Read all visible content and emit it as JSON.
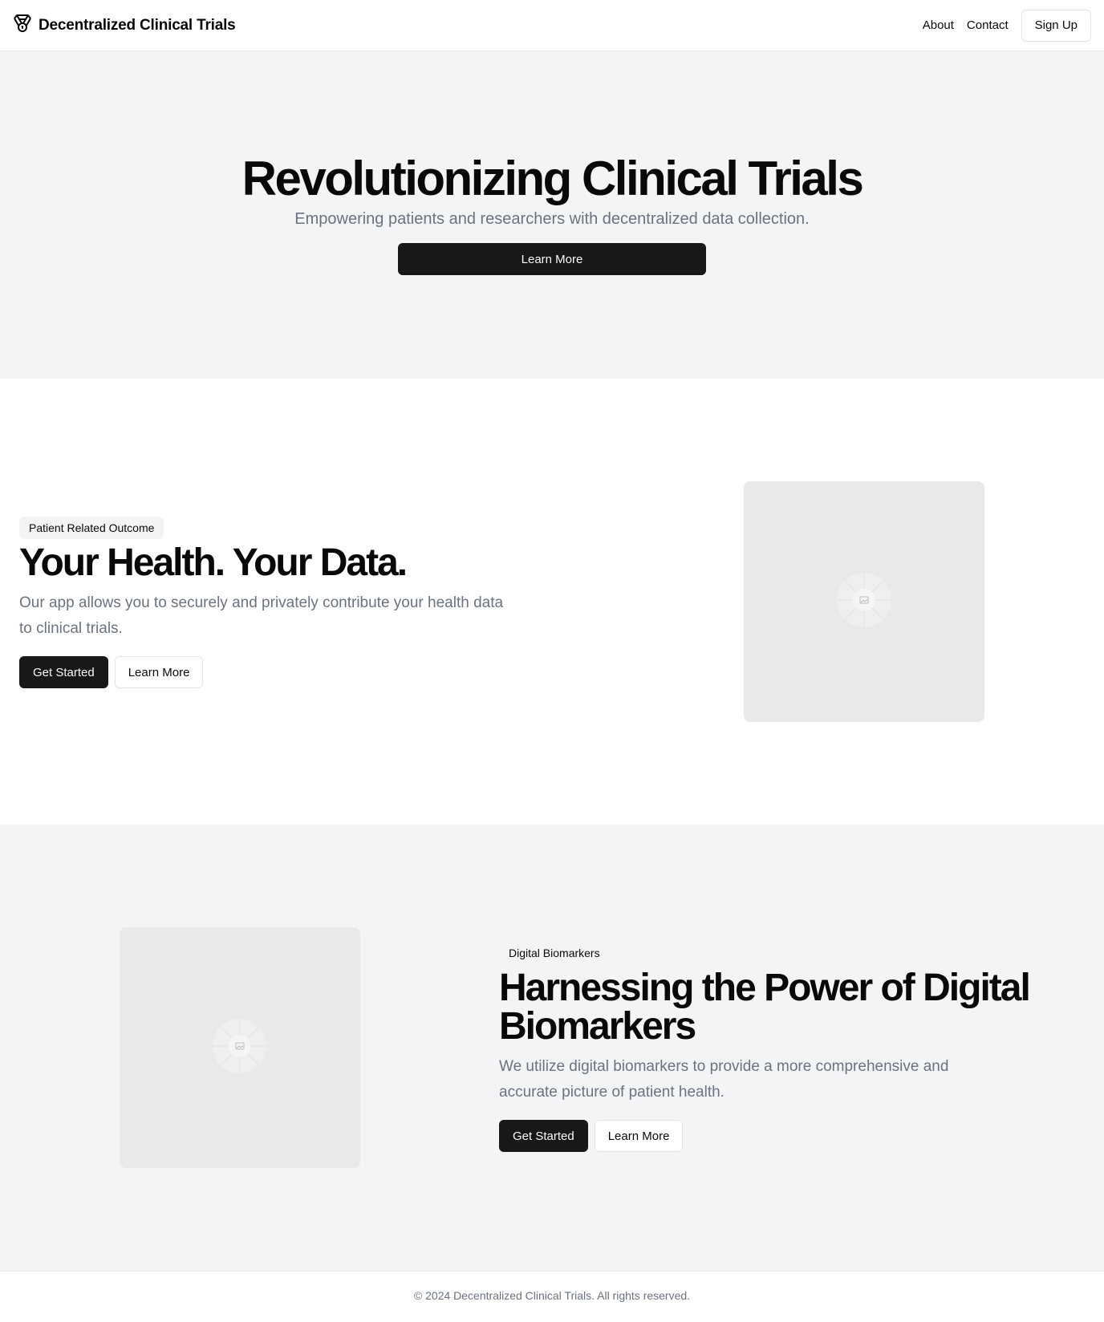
{
  "header": {
    "brand": "Decentralized Clinical Trials",
    "logo_icon": "medal-icon",
    "nav": {
      "about": "About",
      "contact": "Contact"
    },
    "signup": "Sign Up"
  },
  "hero": {
    "title": "Revolutionizing Clinical Trials",
    "subtitle": "Empowering patients and researchers with decentralized data collection.",
    "cta": "Learn More"
  },
  "feature1": {
    "badge": "Patient Related Outcome",
    "title": "Your Health. Your Data.",
    "description": "Our app allows you to securely and privately contribute your health data to clinical trials.",
    "primary": "Get Started",
    "secondary": "Learn More",
    "image_icon": "image-placeholder-icon"
  },
  "feature2": {
    "badge": "Digital Biomarkers",
    "title": "Harnessing the Power of Digital Biomarkers",
    "description": "We utilize digital biomarkers to provide a more comprehensive and accurate picture of patient health.",
    "primary": "Get Started",
    "secondary": "Learn More",
    "image_icon": "image-placeholder-icon"
  },
  "footer": {
    "copyright": "© 2024 Decentralized Clinical Trials. All rights reserved."
  },
  "colors": {
    "dark": "#18181b",
    "muted_text": "#6b7280",
    "section_bg": "#f3f4f6",
    "placeholder_bg": "#e9e9e9"
  }
}
